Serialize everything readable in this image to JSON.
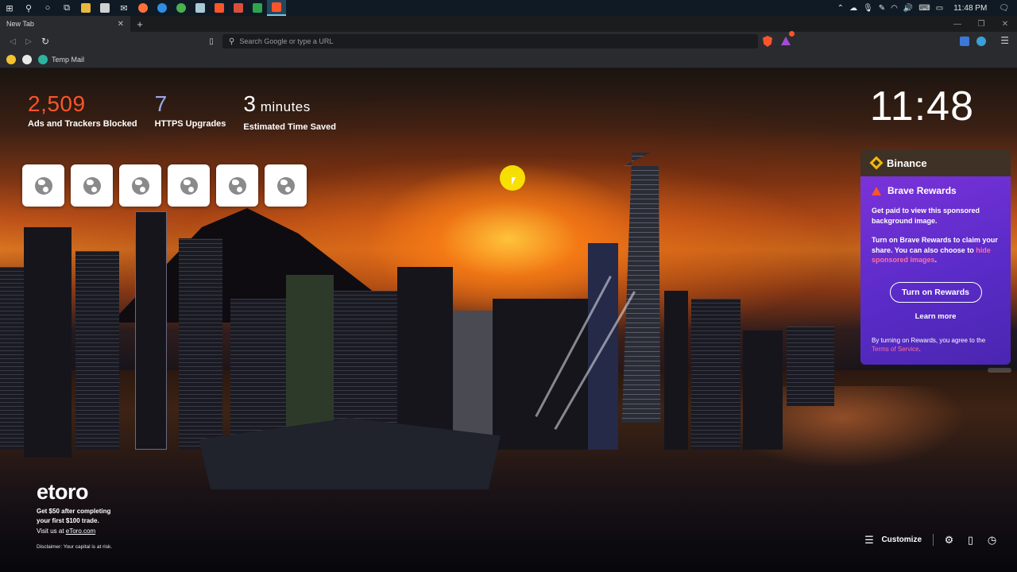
{
  "taskbar": {
    "clock": "11:48 PM"
  },
  "browser": {
    "tab_title": "New Tab",
    "new_tab_label": "+",
    "omnibox_placeholder": "Search Google or type a URL",
    "rewards_badge": "1",
    "bookmarks": [
      {
        "label": ""
      },
      {
        "label": ""
      },
      {
        "label": "Temp Mail"
      }
    ]
  },
  "ntp": {
    "stats": [
      {
        "value": "2,509",
        "unit": "",
        "label": "Ads and Trackers Blocked",
        "color": "#fb542b"
      },
      {
        "value": "7",
        "unit": "",
        "label": "HTTPS Upgrades",
        "color": "#a0a5eb"
      },
      {
        "value": "3",
        "unit": " minutes",
        "label": "Estimated Time Saved",
        "color": "#ffffff"
      }
    ],
    "clock": "11:48",
    "top_sites_count": 6,
    "sponsor": {
      "logo_text": "etoro",
      "tagline_1": "Get $50 after completing",
      "tagline_2": "your first $100 trade.",
      "visit_prefix": "Visit us at ",
      "visit_link": "eToro.com",
      "disclaimer": "Disclaimer: Your capital is at risk."
    },
    "footer": {
      "customize_label": "Customize"
    }
  },
  "card": {
    "header": "Binance",
    "title": "Brave Rewards",
    "para1": "Get paid to view this sponsored background image.",
    "para2_text": "Turn on Brave Rewards to claim your share. You can also choose to ",
    "para2_link": "hide sponsored images",
    "para2_end": ".",
    "button_label": "Turn on Rewards",
    "learn_more": "Learn more",
    "terms_text": "By turning on Rewards, you agree to the ",
    "terms_link": "Terms of Service",
    "terms_end": "."
  },
  "colors": {
    "brave_orange": "#fb542b",
    "rewards_purple": "#7a33d9",
    "binance_yellow": "#f0b90b"
  }
}
